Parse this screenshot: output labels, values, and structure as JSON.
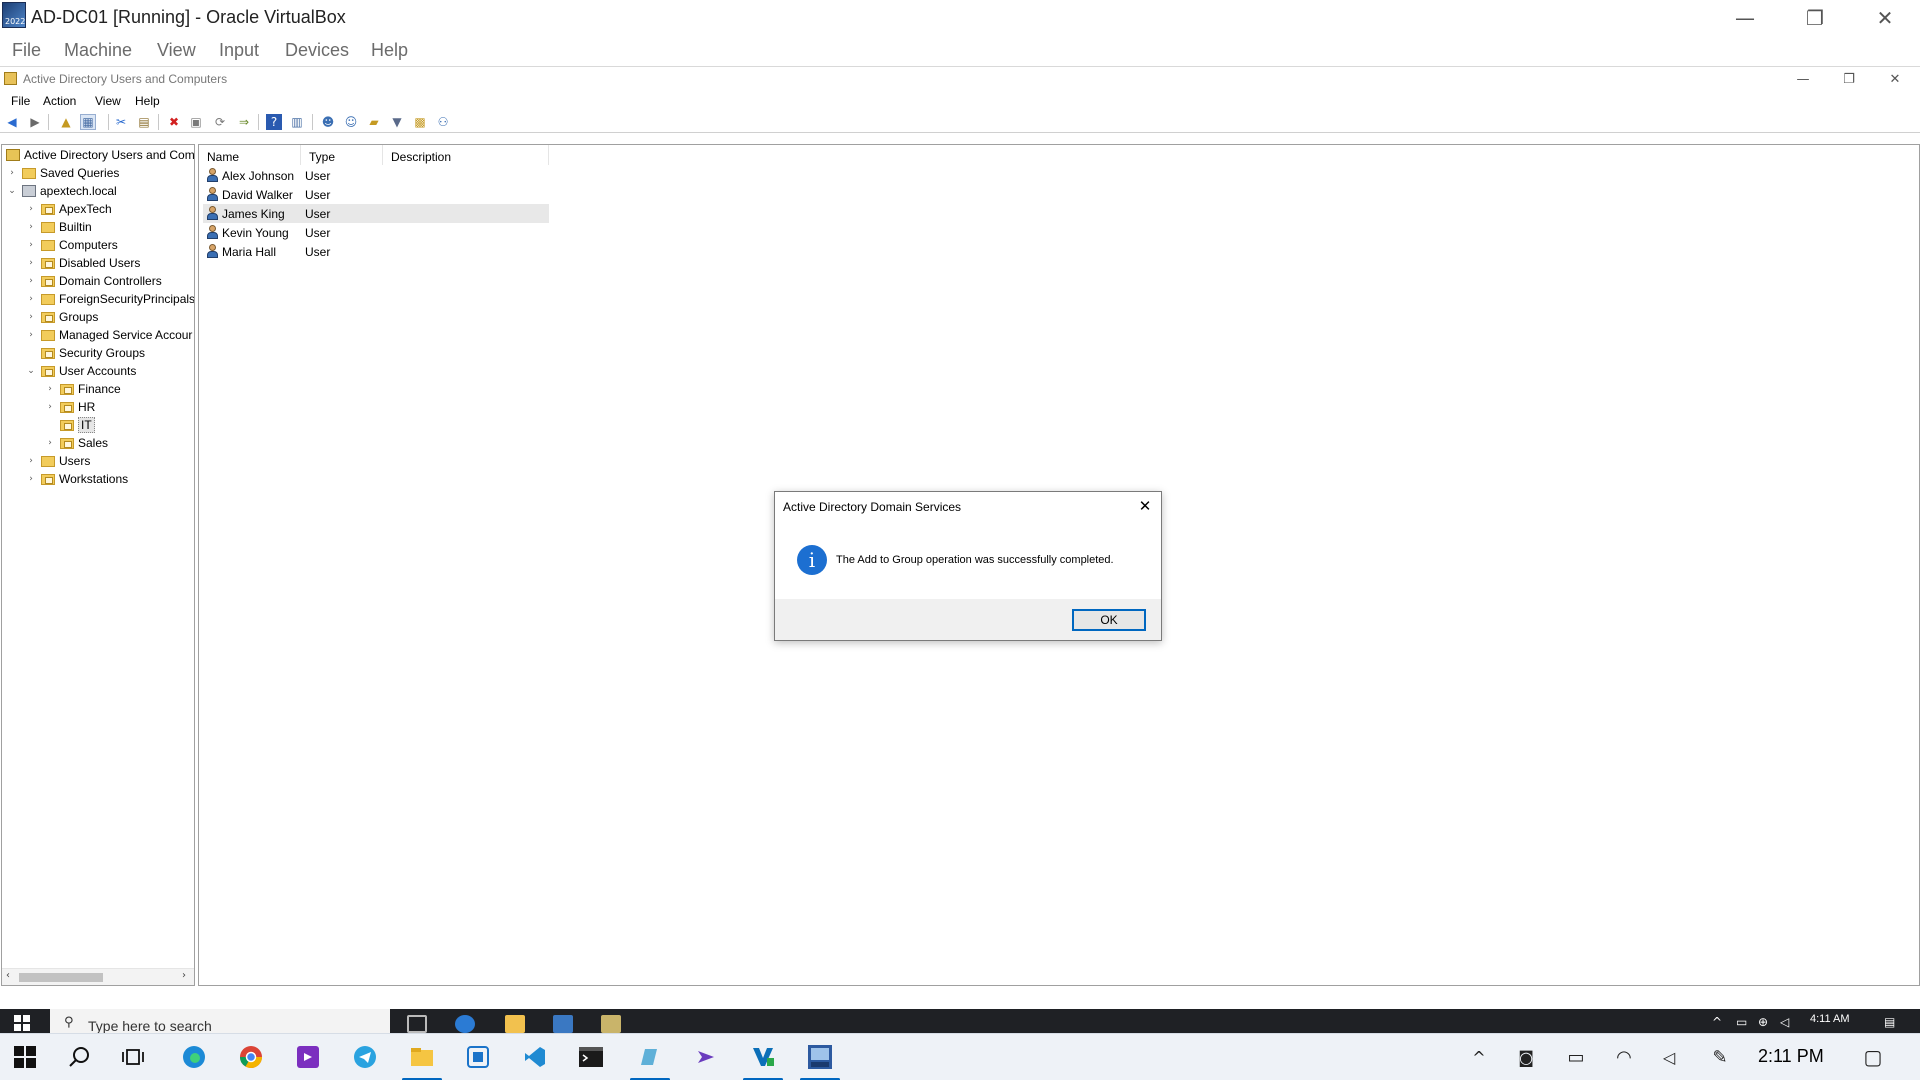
{
  "host": {
    "window_title": "AD-DC01 [Running] - Oracle VirtualBox",
    "app_icon_text": "2022",
    "menu": [
      "File",
      "Machine",
      "View",
      "Input",
      "Devices",
      "Help"
    ],
    "controls": {
      "minimize": "—",
      "restore": "❐",
      "close": "✕"
    }
  },
  "mmc": {
    "window_title": "Active Directory Users and Computers",
    "menu": [
      "File",
      "Action",
      "View",
      "Help"
    ],
    "controls": {
      "minimize": "—",
      "restore": "❐",
      "close": "✕"
    },
    "toolbar": [
      "back-icon",
      "forward-icon",
      "up-icon",
      "show-hide-tree-icon",
      "cut-icon",
      "copy-icon",
      "delete-icon",
      "properties-icon",
      "refresh-icon",
      "export-list-icon",
      "help-icon",
      "view-icon",
      "new-user-icon",
      "new-group-icon",
      "new-ou-icon",
      "filter-icon",
      "add-to-group-icon",
      "delegate-icon"
    ]
  },
  "tree": {
    "items": [
      {
        "label": "Active Directory Users and Com",
        "icon": "root",
        "level": 0,
        "chevron": ""
      },
      {
        "label": "Saved Queries",
        "icon": "folder",
        "level": 1,
        "chevron": "›"
      },
      {
        "label": "apextech.local",
        "icon": "domain",
        "level": 1,
        "chevron": "⌄"
      },
      {
        "label": "ApexTech",
        "icon": "ou",
        "level": 2,
        "chevron": "›"
      },
      {
        "label": "Builtin",
        "icon": "folder",
        "level": 2,
        "chevron": "›"
      },
      {
        "label": "Computers",
        "icon": "folder",
        "level": 2,
        "chevron": "›"
      },
      {
        "label": "Disabled Users",
        "icon": "ou",
        "level": 2,
        "chevron": "›"
      },
      {
        "label": "Domain Controllers",
        "icon": "ou",
        "level": 2,
        "chevron": "›"
      },
      {
        "label": "ForeignSecurityPrincipals",
        "icon": "folder",
        "level": 2,
        "chevron": "›"
      },
      {
        "label": "Groups",
        "icon": "ou",
        "level": 2,
        "chevron": "›"
      },
      {
        "label": "Managed Service Accour",
        "icon": "folder",
        "level": 2,
        "chevron": "›"
      },
      {
        "label": "Security Groups",
        "icon": "ou",
        "level": 2,
        "chevron": ""
      },
      {
        "label": "User Accounts",
        "icon": "ou",
        "level": 2,
        "chevron": "⌄"
      },
      {
        "label": "Finance",
        "icon": "ou",
        "level": 3,
        "chevron": "›"
      },
      {
        "label": "HR",
        "icon": "ou",
        "level": 3,
        "chevron": "›"
      },
      {
        "label": "IT",
        "icon": "ou",
        "level": 3,
        "chevron": "",
        "selected": true
      },
      {
        "label": "Sales",
        "icon": "ou",
        "level": 3,
        "chevron": "›"
      },
      {
        "label": "Users",
        "icon": "folder",
        "level": 2,
        "chevron": "›"
      },
      {
        "label": "Workstations",
        "icon": "ou",
        "level": 2,
        "chevron": "›"
      }
    ],
    "scroll_left": "‹",
    "scroll_right": "›"
  },
  "details": {
    "columns": [
      "Name",
      "Type",
      "Description"
    ],
    "rows": [
      {
        "name": "Alex Johnson",
        "type": "User"
      },
      {
        "name": "David Walker",
        "type": "User"
      },
      {
        "name": "James King",
        "type": "User",
        "highlighted": true
      },
      {
        "name": "Kevin Young",
        "type": "User"
      },
      {
        "name": "Maria Hall",
        "type": "User"
      }
    ]
  },
  "dialog": {
    "title": "Active Directory Domain Services",
    "close": "✕",
    "icon": "info-icon",
    "icon_glyph": "i",
    "message": "The Add to Group operation was successfully completed.",
    "ok_label": "OK"
  },
  "guest_taskbar": {
    "search_placeholder": "Type here to search",
    "search_glyph": "⚲",
    "clock": "4:11 AM"
  },
  "host_taskbar": {
    "clock": "2:11 PM",
    "tray_glyphs": {
      "chevron": "^",
      "mic": "◙",
      "battery": "▭",
      "wifi": "◠",
      "volume": "◁",
      "pen": "✎",
      "notifications": "▢"
    }
  },
  "colors": {
    "accent": "#0067c0",
    "info_icon": "#1c6fd1",
    "folder": "#f2cc5b"
  }
}
